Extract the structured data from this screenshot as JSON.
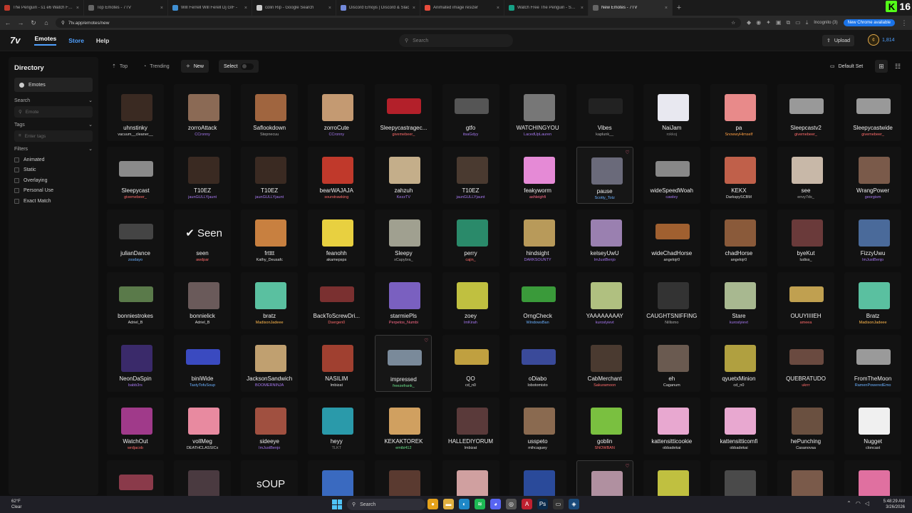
{
  "browser": {
    "tabs": [
      {
        "title": "The Penguin - s1 e6 Watch Free",
        "color": "#c0392b"
      },
      {
        "title": "Top Emotes - 7TV",
        "color": "#666666"
      },
      {
        "title": "Will Ferrell Will Ferell Dj GIF - ",
        "color": "#3f8fd2"
      },
      {
        "title": "colin Rip - Google Search",
        "color": "#cccccc"
      },
      {
        "title": "Discord Emojis | Discord & Slac",
        "color": "#7289da"
      },
      {
        "title": "Animated image resizer",
        "color": "#e74c3c"
      },
      {
        "title": "Watch Free The Penguin - Seas",
        "color": "#16a085"
      },
      {
        "title": "New Emotes - 7TV",
        "color": "#666666",
        "active": true
      }
    ],
    "url": "7tv.app/emotes/new",
    "incognito": "Incognito (3)",
    "new_chrome": "New Chrome available",
    "kick_count": "16"
  },
  "site": {
    "logo": "7v",
    "nav": {
      "emotes": "Emotes",
      "store": "Store",
      "help": "Help"
    },
    "search_placeholder": "Search",
    "upload": "Upload",
    "coins": "1,814"
  },
  "sidebar": {
    "title": "Directory",
    "emotes": "Emotes",
    "search_label": "Search",
    "search_placeholder": "Emote",
    "tags_label": "Tags",
    "tags_placeholder": "Enter tags",
    "filters_label": "Filters",
    "filters": [
      "Animated",
      "Static",
      "Overlaying",
      "Personal Use",
      "Exact Match"
    ]
  },
  "toolbar": {
    "top": "Top",
    "trending": "Trending",
    "new": "New",
    "select": "Select",
    "default_set": "Default Set"
  },
  "emotes": [
    {
      "name": "uhnstinky",
      "owner": "vacuum__cleaner__",
      "oc": "#dddddd",
      "tc": "#3a2a22"
    },
    {
      "name": "zorroAttack",
      "owner": "CCronny",
      "oc": "#a678f0",
      "tc": "#8b6a55"
    },
    {
      "name": "Saflookdown",
      "owner": "Stepnecuu",
      "oc": "#aaaaaa",
      "tc": "#a0653f"
    },
    {
      "name": "zorroCute",
      "owner": "CCronny",
      "oc": "#a678f0",
      "tc": "#c49a72"
    },
    {
      "name": "Sleepycastragec...",
      "owner": "givemebeer_",
      "oc": "#ff6b6b",
      "tc": "#b3202a",
      "wide": true
    },
    {
      "name": "gtfo",
      "owner": "itsaGdyy",
      "oc": "#a678f0",
      "tc": "#555555",
      "wide": true
    },
    {
      "name": "WATCHINGYOU",
      "owner": "LacedUpLauren",
      "oc": "#a678f0",
      "tc": "#777777"
    },
    {
      "name": "Vibes",
      "owner": "kaplunk__",
      "oc": "#aaaaaa",
      "tc": "#222222",
      "wide": true
    },
    {
      "name": "NaiJam",
      "owner": "rokkoj",
      "oc": "#888888",
      "tc": "#e8e8f0"
    },
    {
      "name": "pa",
      "owner": "SnowwyHimself",
      "oc": "#ff9f43",
      "tc": "#e88a8a"
    },
    {
      "name": "Sleepcastv2",
      "owner": "givemebeer_",
      "oc": "#ff6b6b",
      "tc": "#999999",
      "wide": true
    },
    {
      "name": "Sleepycastwide",
      "owner": "givemebeer_",
      "oc": "#ff6b6b",
      "tc": "#999999",
      "wide": true
    },
    {
      "name": "Sleepycast",
      "owner": "givemebeer_",
      "oc": "#ff6b6b",
      "tc": "#8a8a8a",
      "wide": true
    },
    {
      "name": "T10EZ",
      "owner": "jaunGULLYjaunt",
      "oc": "#a678f0",
      "tc": "#3a2a22"
    },
    {
      "name": "T10EZ",
      "owner": "jaunGULLYjaunt",
      "oc": "#a678f0",
      "tc": "#3a2a22"
    },
    {
      "name": "bearWAJAJA",
      "owner": "sourstrawking",
      "oc": "#ff6b6b",
      "tc": "#c0392b"
    },
    {
      "name": "zahzuh",
      "owner": "KezzTV",
      "oc": "#a678f0",
      "tc": "#c4ae8a"
    },
    {
      "name": "T10EZ",
      "owner": "jaunGULLYjaunt",
      "oc": "#a678f0",
      "tc": "#4a3a30"
    },
    {
      "name": "feakyworm",
      "owner": "ashleighfi",
      "oc": "#ff6b8a",
      "tc": "#e58ad6"
    },
    {
      "name": "pause",
      "owner": "Scotty_Totz",
      "oc": "#6ab0ff",
      "tc": "#6a6a7a",
      "hl": true,
      "fav": true
    },
    {
      "name": "wideSpeedWoah",
      "owner": "cawley",
      "oc": "#a678f0",
      "tc": "#888888",
      "wide": true
    },
    {
      "name": "KEKX",
      "owner": "DarkspySCBM",
      "oc": "#dddddd",
      "tc": "#c0604a"
    },
    {
      "name": "see",
      "owner": "envy7ds_",
      "oc": "#aaaaaa",
      "tc": "#c8b8a8"
    },
    {
      "name": "WrangPower",
      "owner": "georgism",
      "oc": "#a678f0",
      "tc": "#7a5a4a"
    },
    {
      "name": "julianDance",
      "owner": "zxsdayo",
      "oc": "#6ab0ff",
      "tc": "#444444",
      "wide": true
    },
    {
      "name": "seen",
      "owner": "awdpar",
      "oc": "#ff6b6b",
      "tc": "#111111",
      "text": "✔ Seen"
    },
    {
      "name": "frtttt",
      "owner": "Kathy_Deusafc",
      "oc": "#dddddd",
      "tc": "#c88040"
    },
    {
      "name": "feanohh",
      "owner": "akamepsps",
      "oc": "#dddddd",
      "tc": "#e8d040"
    },
    {
      "name": "Sleepy",
      "owner": "xCapybra_",
      "oc": "#aaaaaa",
      "tc": "#a0a090"
    },
    {
      "name": "perry",
      "owner": "cajin_",
      "oc": "#ff6b6b",
      "tc": "#2a8a6a"
    },
    {
      "name": "hindsight",
      "owner": "DARKSOUNTY",
      "oc": "#a678f0",
      "tc": "#b89a5a"
    },
    {
      "name": "kelseyUwU",
      "owner": "ImJustBenjo",
      "oc": "#a678f0",
      "tc": "#9a80b0"
    },
    {
      "name": "wideChadHorse",
      "owner": "angelojr0",
      "oc": "#dddddd",
      "tc": "#a06030",
      "wide": true
    },
    {
      "name": "chadHorse",
      "owner": "angelojr0",
      "oc": "#dddddd",
      "tc": "#8a5a3a"
    },
    {
      "name": "byeKut",
      "owner": "ludiss_",
      "oc": "#dddddd",
      "tc": "#6a3a3a"
    },
    {
      "name": "FizzyUwu",
      "owner": "ImJustBenjo",
      "oc": "#a678f0",
      "tc": "#4a6a9a"
    },
    {
      "name": "bonniestrokes",
      "owner": "Adriel_B",
      "oc": "#dddddd",
      "tc": "#5a7a4a",
      "wide": true
    },
    {
      "name": "bonnielick",
      "owner": "Adriel_B",
      "oc": "#dddddd",
      "tc": "#6a5a5a"
    },
    {
      "name": "bratz",
      "owner": "MadisonJadeee",
      "oc": "#ffb84d",
      "tc": "#5ac0a0"
    },
    {
      "name": "BackToScrewDri...",
      "owner": "Dsergen0",
      "oc": "#ff6b6b",
      "tc": "#7a3030",
      "wide": true
    },
    {
      "name": "starmiePls",
      "owner": "Perpetos_Numbi",
      "oc": "#ff6b8a",
      "tc": "#7a60c0"
    },
    {
      "name": "zoey",
      "owner": "lmKirah",
      "oc": "#a678f0",
      "tc": "#c0c040"
    },
    {
      "name": "OrngCheck",
      "owner": "WindowsBan",
      "oc": "#6ab0ff",
      "tc": "#3a9a3a",
      "wide": true
    },
    {
      "name": "YAAAAAAAAY",
      "owner": "kuroslyievt",
      "oc": "#a678f0",
      "tc": "#b0c080"
    },
    {
      "name": "CAUGHTSNIFFING",
      "owner": "Nillismo",
      "oc": "#aaaaaa",
      "tc": "#333333"
    },
    {
      "name": "Stare",
      "owner": "kuroslyievt",
      "oc": "#a678f0",
      "tc": "#a8b890"
    },
    {
      "name": "OUUYIIIIEH",
      "owner": "ameea",
      "oc": "#ff6b6b",
      "tc": "#c0a050",
      "wide": true
    },
    {
      "name": "Bratz",
      "owner": "MadisonJadeee",
      "oc": "#ffb84d",
      "tc": "#5ac0a0"
    },
    {
      "name": "NeonDaSpin",
      "owner": "babb3rs",
      "oc": "#a678f0",
      "tc": "#3a2a6a"
    },
    {
      "name": "biniWide",
      "owner": "TastyTofuSoup",
      "oc": "#6ab0ff",
      "tc": "#3a4ac0",
      "wide": true
    },
    {
      "name": "JacksonSandwich",
      "owner": "BOOMERNINJA",
      "oc": "#a678f0",
      "tc": "#c0a070"
    },
    {
      "name": "NASILIM",
      "owner": "lmbizat",
      "oc": "#dddddd",
      "tc": "#a04030"
    },
    {
      "name": "impressed",
      "owner": "freezefrank_",
      "oc": "#6ae08a",
      "tc": "#7a8a9a",
      "hl": true,
      "fav": true,
      "wide": true
    },
    {
      "name": "QO",
      "owner": "cd_n0",
      "oc": "#dddddd",
      "tc": "#c0a040",
      "wide": true
    },
    {
      "name": "oDiabo",
      "owner": "lobotomisto",
      "oc": "#dddddd",
      "tc": "#3a4a9a",
      "wide": true
    },
    {
      "name": "CabMerchant",
      "owner": "Sakuramoon",
      "oc": "#ff6b6b",
      "tc": "#4a3a30"
    },
    {
      "name": "eh",
      "owner": "Caganum",
      "oc": "#dddddd",
      "tc": "#6a5a50"
    },
    {
      "name": "qyuetxMinion",
      "owner": "cd_n0",
      "oc": "#dddddd",
      "tc": "#b0a040"
    },
    {
      "name": "QUEBRATUDO",
      "owner": "ukrrr",
      "oc": "#ff6b6b",
      "tc": "#6a4a40",
      "wide": true
    },
    {
      "name": "FromTheMoon",
      "owner": "RamenPoweredEmo",
      "oc": "#6ab0ff",
      "tc": "#9a9a9a",
      "wide": true
    },
    {
      "name": "WatchOut",
      "owner": "wrdjacob",
      "oc": "#ff6b6b",
      "tc": "#a03a8a"
    },
    {
      "name": "vollMeg",
      "owner": "DEATHCLASSICx",
      "oc": "#dddddd",
      "tc": "#e88aa0"
    },
    {
      "name": "sideeye",
      "owner": "ImJustBenjo",
      "oc": "#a678f0",
      "tc": "#a05040"
    },
    {
      "name": "heyy",
      "owner": "TLKT",
      "oc": "#888888",
      "tc": "#2a9aaa"
    },
    {
      "name": "KEKAKTOREK",
      "owner": "emibi412",
      "oc": "#6ae08a",
      "tc": "#d0a060"
    },
    {
      "name": "HALLEDIYORUM",
      "owner": "lmbizat",
      "oc": "#dddddd",
      "tc": "#5a3a3a"
    },
    {
      "name": "usspeto",
      "owner": "mihcaguey",
      "oc": "#dddddd",
      "tc": "#8a6a50"
    },
    {
      "name": "goblin",
      "owner": "SNOWBAN",
      "oc": "#ff6b6b",
      "tc": "#7ac040"
    },
    {
      "name": "kattensitticookie",
      "owner": "obbadekai",
      "oc": "#dddddd",
      "tc": "#e8a8d0"
    },
    {
      "name": "kattensitticomfi",
      "owner": "obbadekai",
      "oc": "#dddddd",
      "tc": "#e8a8d0"
    },
    {
      "name": "hePunching",
      "owner": "Casanovaa",
      "oc": "#dddddd",
      "tc": "#6a5040"
    },
    {
      "name": "Nugget",
      "owner": "cloncast",
      "oc": "#dddddd",
      "tc": "#f0f0f0"
    },
    {
      "name": "",
      "owner": "",
      "oc": "#dddddd",
      "tc": "#8a3a4a",
      "wide": true
    },
    {
      "name": "",
      "owner": "",
      "oc": "#dddddd",
      "tc": "#4a3a40"
    },
    {
      "name": "",
      "owner": "",
      "oc": "#dddddd",
      "tc": "#111111",
      "text": "sOUP"
    },
    {
      "name": "",
      "owner": "",
      "oc": "#dddddd",
      "tc": "#3a6ac0"
    },
    {
      "name": "",
      "owner": "",
      "oc": "#dddddd",
      "tc": "#5a3a30"
    },
    {
      "name": "",
      "owner": "",
      "oc": "#dddddd",
      "tc": "#d0a0a0"
    },
    {
      "name": "",
      "owner": "",
      "oc": "#dddddd",
      "tc": "#2a4a9a"
    },
    {
      "name": "",
      "owner": "",
      "oc": "#dddddd",
      "tc": "#b090a0",
      "hl": true,
      "fav": true
    },
    {
      "name": "",
      "owner": "",
      "oc": "#dddddd",
      "tc": "#c0c040"
    },
    {
      "name": "",
      "owner": "",
      "oc": "#dddddd",
      "tc": "#4a4a4a"
    },
    {
      "name": "",
      "owner": "",
      "oc": "#dddddd",
      "tc": "#7a5a4a"
    },
    {
      "name": "",
      "owner": "",
      "oc": "#dddddd",
      "tc": "#e070a0"
    }
  ],
  "taskbar": {
    "weather_temp": "62°F",
    "weather_text": "Clear",
    "search": "Search",
    "time": "5:48:29 AM",
    "date": "3/26/2026"
  }
}
